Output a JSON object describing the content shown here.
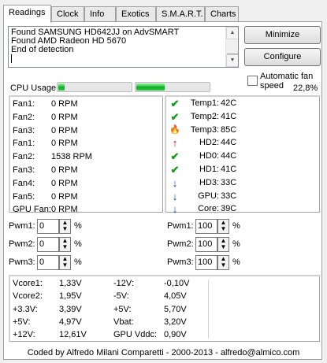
{
  "tabs": [
    "Readings",
    "Clock",
    "Info",
    "Exotics",
    "S.M.A.R.T.",
    "Charts"
  ],
  "log": {
    "lines": [
      "Found SAMSUNG HD642JJ on AdvSMART",
      "Found AMD Radeon HD 5670",
      "End of detection"
    ]
  },
  "buttons": {
    "minimize": "Minimize",
    "configure": "Configure"
  },
  "auto_fan": {
    "label_line1": "Automatic fan",
    "label_line2": "speed",
    "checked": false
  },
  "cpu": {
    "label": "CPU Usage",
    "percent_text": "22,8%",
    "core1_fill": 0.08,
    "core2_fill": 0.38,
    "accent": "#06b025"
  },
  "fans": [
    {
      "name": "Fan1:",
      "value": "0 RPM"
    },
    {
      "name": "Fan2:",
      "value": "0 RPM"
    },
    {
      "name": "Fan3:",
      "value": "0 RPM"
    },
    {
      "name": "Fan1:",
      "value": "0 RPM"
    },
    {
      "name": "Fan2:",
      "value": "1538 RPM"
    },
    {
      "name": "Fan3:",
      "value": "0 RPM"
    },
    {
      "name": "Fan4:",
      "value": "0 RPM"
    },
    {
      "name": "Fan5:",
      "value": "0 RPM"
    },
    {
      "name": "GPU Fan:",
      "value": "0 RPM"
    }
  ],
  "temps": [
    {
      "icon": "check-icon",
      "name": "Temp1:",
      "value": "42C"
    },
    {
      "icon": "check-icon",
      "name": "Temp2:",
      "value": "41C"
    },
    {
      "icon": "flame-icon",
      "name": "Temp3:",
      "value": "85C"
    },
    {
      "icon": "arrow-up-icon",
      "name": "HD2:",
      "value": "44C"
    },
    {
      "icon": "check-icon",
      "name": "HD0:",
      "value": "44C"
    },
    {
      "icon": "check-icon",
      "name": "HD1:",
      "value": "41C"
    },
    {
      "icon": "arrow-down-icon",
      "name": "HD3:",
      "value": "33C"
    },
    {
      "icon": "arrow-down-icon",
      "name": "GPU:",
      "value": "33C"
    },
    {
      "icon": "arrow-down-icon",
      "name": "Core:",
      "value": "39C"
    }
  ],
  "pwm_left": [
    {
      "label": "Pwm1:",
      "value": "0",
      "unit": "%"
    },
    {
      "label": "Pwm2:",
      "value": "0",
      "unit": "%"
    },
    {
      "label": "Pwm3:",
      "value": "0",
      "unit": "%"
    }
  ],
  "pwm_right": [
    {
      "label": "Pwm1:",
      "value": "100",
      "unit": "%"
    },
    {
      "label": "Pwm2:",
      "value": "100",
      "unit": "%"
    },
    {
      "label": "Pwm3:",
      "value": "100",
      "unit": "%"
    }
  ],
  "voltages_left": [
    {
      "name": "Vcore1:",
      "value": "1,33V"
    },
    {
      "name": "Vcore2:",
      "value": "1,95V"
    },
    {
      "name": "+3.3V:",
      "value": "3,39V"
    },
    {
      "name": "+5V:",
      "value": "4,97V"
    },
    {
      "name": "+12V:",
      "value": "12,61V"
    }
  ],
  "voltages_right": [
    {
      "name": "-12V:",
      "value": "-0,10V"
    },
    {
      "name": "-5V:",
      "value": "4,05V"
    },
    {
      "name": "+5V:",
      "value": "5,70V"
    },
    {
      "name": "Vbat:",
      "value": "3,20V"
    },
    {
      "name": "GPU Vddc:",
      "value": "0,90V"
    }
  ],
  "footer": "Coded by Alfredo Milani Comparetti - 2000-2013 - alfredo@almico.com"
}
